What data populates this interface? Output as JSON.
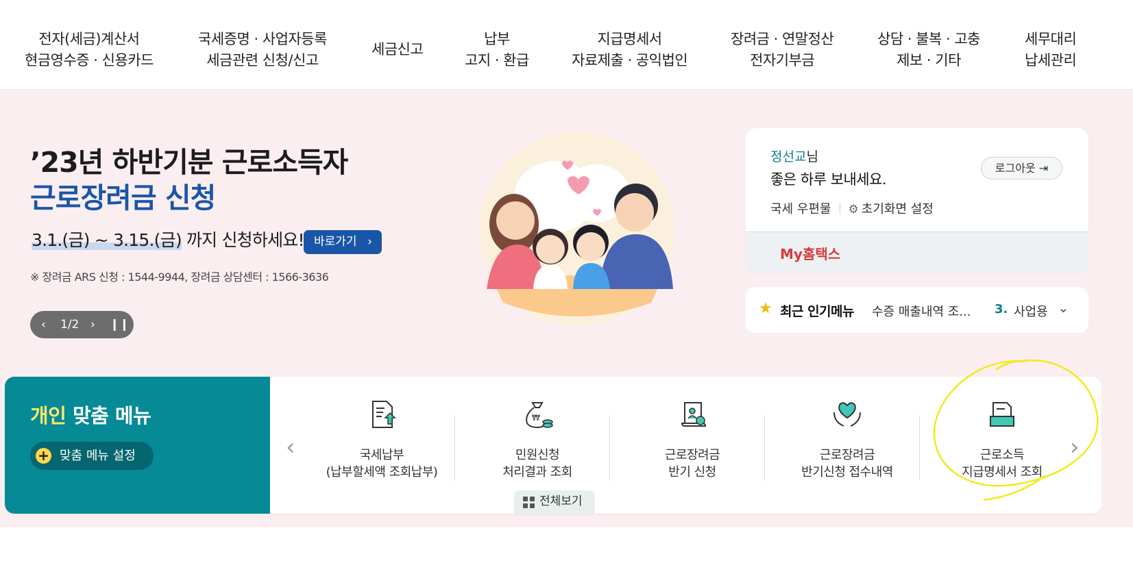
{
  "nav": {
    "items": [
      {
        "line1": "전자(세금)계산서",
        "line2": "현금영수증 · 신용카드"
      },
      {
        "line1": "국세증명 · 사업자등록",
        "line2": "세금관련 신청/신고"
      },
      {
        "line1": "세금신고",
        "line2": ""
      },
      {
        "line1": "납부",
        "line2": "고지 · 환급"
      },
      {
        "line1": "지급명세서",
        "line2": "자료제출 · 공익법인"
      },
      {
        "line1": "장려금 · 연말정산",
        "line2": "전자기부금"
      },
      {
        "line1": "상담 · 불복 · 고충",
        "line2": "제보 · 기타"
      },
      {
        "line1": "세무대리",
        "line2": "납세관리"
      }
    ]
  },
  "hero": {
    "title_line1": "’23년 하반기분 근로소득자",
    "title_line2": "근로장려금 신청",
    "period_highlight": "3.1.(금) ~ 3.15.(금)",
    "period_rest": " 까지 신청하세요!",
    "go_button": "바로가기",
    "note": "※ 장려금 ARS 신청 : 1544-9944, 장려금 상담센터 : 1566-3636",
    "slide_indicator": "1/2"
  },
  "login": {
    "user_name": "정선교",
    "user_suffix": "님",
    "greeting": "좋은 하루 보내세요.",
    "logout_label": "로그아웃",
    "link_mail": "국세 우편물",
    "link_setting": "초기화면 설정",
    "my_hometax": "My홈택스"
  },
  "popular": {
    "label": "최근 인기메뉴",
    "item1": "수증 매출내역 조...",
    "rank2": "3.",
    "item2": "사업용"
  },
  "custom_menu": {
    "title_highlight": "개인",
    "title_rest": " 맞춤 메뉴",
    "setting_button": "맞춤 메뉴 설정",
    "view_all": "전체보기",
    "cards": [
      {
        "line1": "국세납부",
        "line2": "(납부할세액 조회납부)",
        "icon": "tax-payment-document-icon"
      },
      {
        "line1": "민원신청",
        "line2": "처리결과 조회",
        "icon": "money-bag-coins-icon"
      },
      {
        "line1": "근로장려금",
        "line2": "반기 신청",
        "icon": "application-scroll-icon"
      },
      {
        "line1": "근로장려금",
        "line2": "반기신청 접수내역",
        "icon": "heart-hands-icon"
      },
      {
        "line1": "근로소득",
        "line2": "지급명세서 조회",
        "icon": "folder-tray-icon"
      }
    ]
  },
  "colors": {
    "brand_teal": "#068a96",
    "hero_bg": "#fbeef0",
    "accent_blue": "#1a56a8",
    "highlight_red": "#d83a3a",
    "annotation_yellow": "#f2ea1a"
  }
}
